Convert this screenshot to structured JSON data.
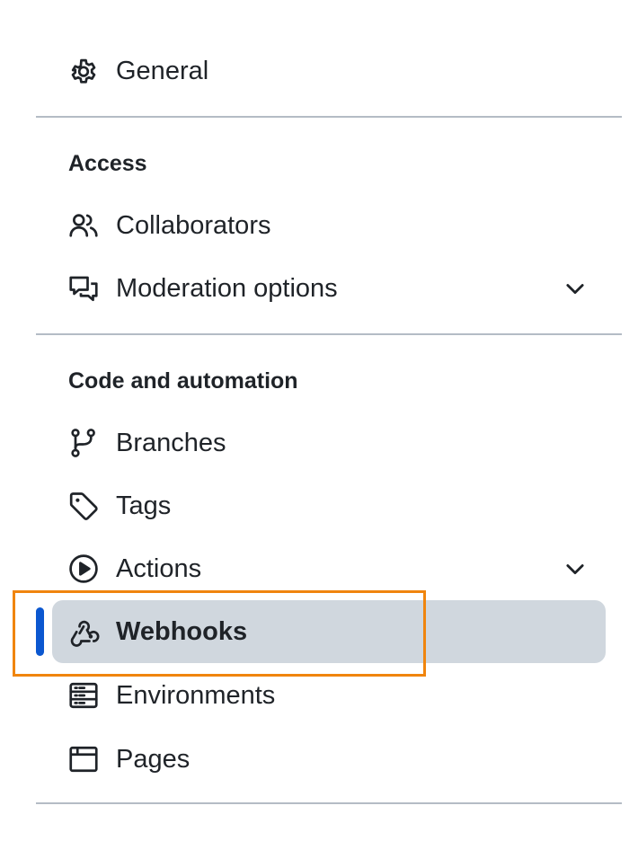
{
  "nav": {
    "general": {
      "label": "General",
      "icon": "gear-icon"
    },
    "access": {
      "heading": "Access",
      "items": [
        {
          "label": "Collaborators",
          "icon": "people-icon"
        },
        {
          "label": "Moderation options",
          "icon": "comment-discussion-icon",
          "expandable": true
        }
      ]
    },
    "code_automation": {
      "heading": "Code and automation",
      "items": [
        {
          "label": "Branches",
          "icon": "git-branch-icon"
        },
        {
          "label": "Tags",
          "icon": "tag-icon"
        },
        {
          "label": "Actions",
          "icon": "play-icon",
          "expandable": true
        },
        {
          "label": "Webhooks",
          "icon": "webhook-icon",
          "selected": true
        },
        {
          "label": "Environments",
          "icon": "server-icon"
        },
        {
          "label": "Pages",
          "icon": "browser-icon"
        }
      ]
    }
  },
  "colors": {
    "active_indicator": "#0b57d0",
    "active_background": "#d0d7de",
    "highlight_outline": "#f0850e",
    "divider": "#b4bcc5",
    "text": "#1f2328"
  }
}
